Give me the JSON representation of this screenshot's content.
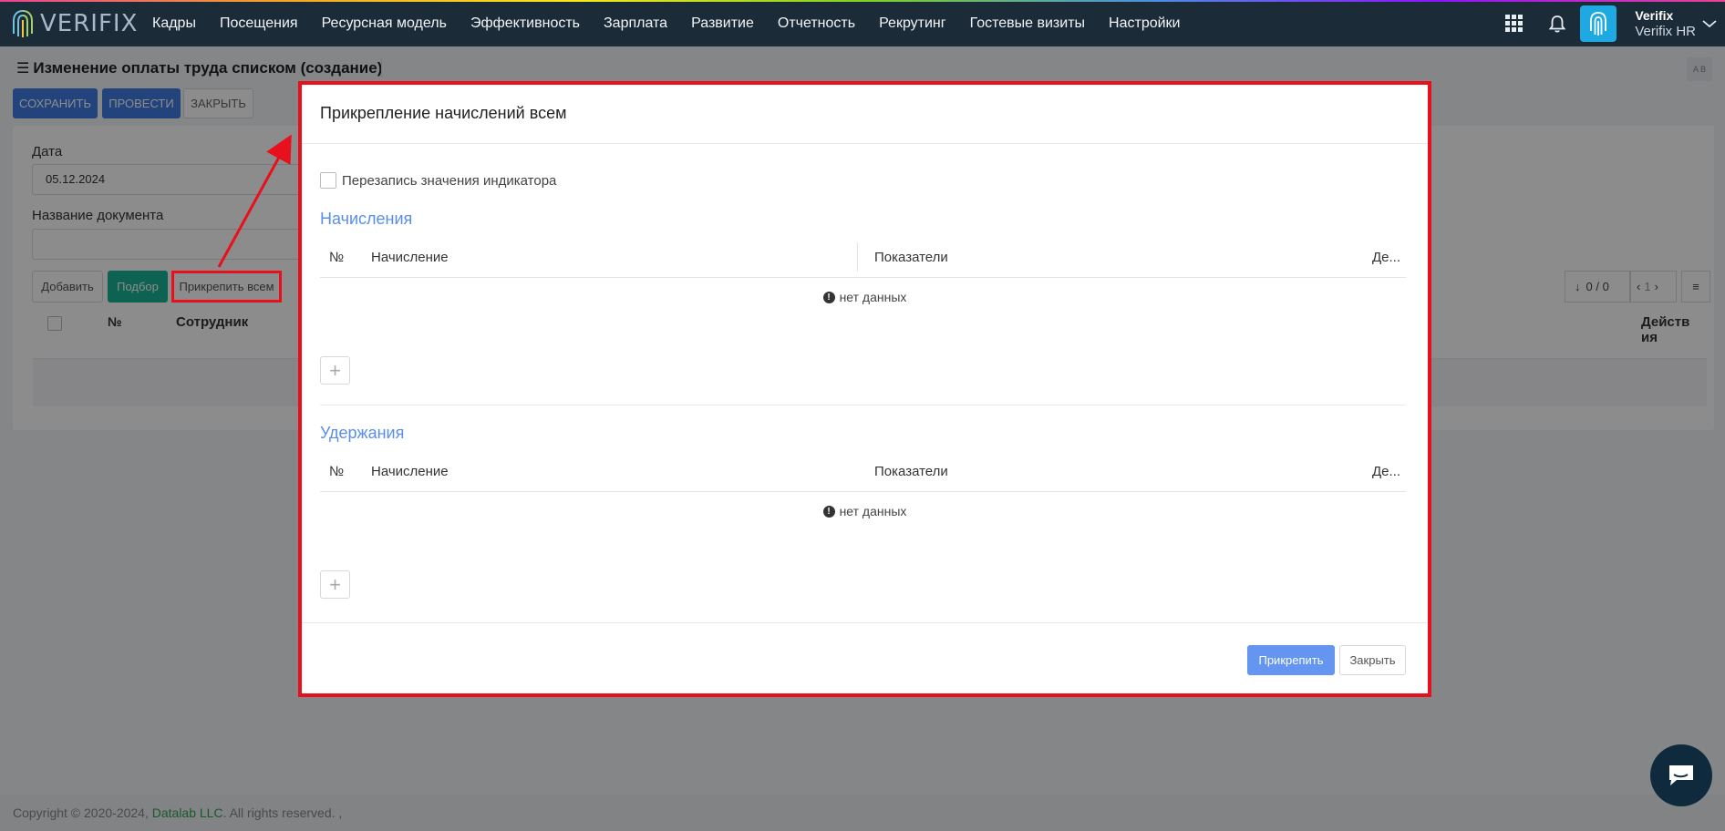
{
  "topnav": {
    "logo_text": "VERIFIX",
    "menu": [
      "Кадры",
      "Посещения",
      "Ресурсная модель",
      "Эффективность",
      "Зарплата",
      "Развитие",
      "Отчетность",
      "Рекрутинг",
      "Гостевые визиты",
      "Настройки"
    ],
    "user_name": "Verifix",
    "user_sub": "Verifix HR"
  },
  "page": {
    "title": "Изменение оплаты труда списком (создание)",
    "corner_label": "A B",
    "toolbar": {
      "save": "Сохранить",
      "post": "Провести",
      "close": "Закрыть"
    },
    "date_label": "Дата",
    "date_value": "05.12.2024",
    "docname_label": "Название документа",
    "docname_value": "",
    "buttons": {
      "add": "Добавить",
      "pick": "Подбор",
      "attach_all": "Прикрепить всем"
    },
    "pager": {
      "count": "0 / 0",
      "page": "1"
    },
    "table_headers": {
      "num": "№",
      "employee": "Сотрудник",
      "actions": "Действия"
    }
  },
  "modal": {
    "title": "Прикрепление начислений всем",
    "overwrite_label": "Перезапись значения индикатора",
    "accruals": {
      "title": "Начисления",
      "headers": [
        "№",
        "Начисление",
        "Показатели",
        "Де..."
      ],
      "nodata": "нет данных"
    },
    "deductions": {
      "title": "Удержания",
      "headers": [
        "№",
        "Начисление",
        "Показатели",
        "Де..."
      ],
      "nodata": "нет данных"
    },
    "attach_button": "Прикрепить",
    "close_button": "Закрыть"
  },
  "footer": {
    "prefix": "Copyright © 2020-2024,",
    "link": "Datalab LLC",
    "suffix": ". All rights reserved. ,"
  },
  "colors": {
    "accent": "#3f7ae0",
    "teal": "#1ab394",
    "highlight": "#e8101c",
    "nav_bg": "#1b2b38"
  }
}
